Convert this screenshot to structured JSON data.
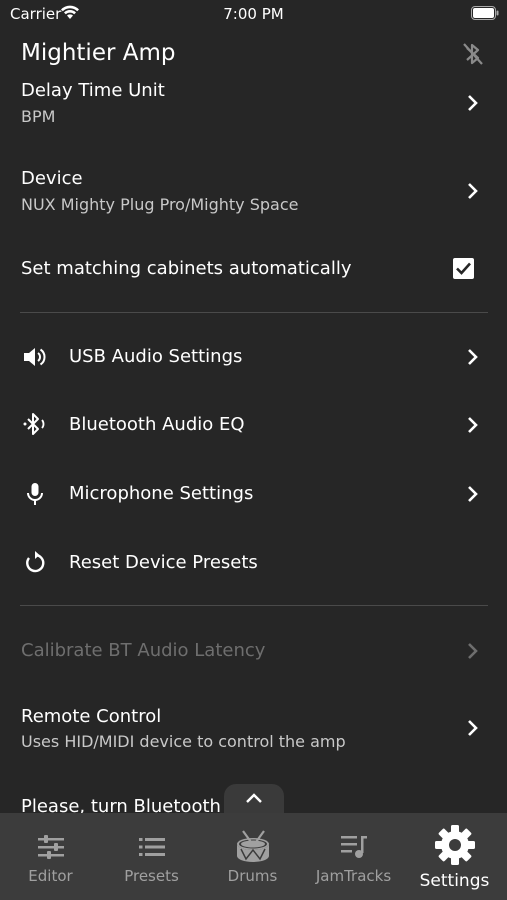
{
  "status": {
    "carrier": "Carrier",
    "time": "7:00 PM"
  },
  "app": {
    "title": "Mightier Amp"
  },
  "settings": {
    "delay_time_unit": {
      "title": "Delay Time Unit",
      "value": "BPM"
    },
    "device": {
      "title": "Device",
      "value": "NUX Mighty Plug Pro/Mighty Space"
    },
    "matching_cabinets": {
      "title": "Set matching cabinets automatically",
      "checked": true
    },
    "usb_audio": {
      "title": "USB Audio Settings",
      "icon": "speaker-icon"
    },
    "bt_audio_eq": {
      "title": "Bluetooth Audio EQ",
      "icon": "bluetooth-audio-icon"
    },
    "microphone": {
      "title": "Microphone Settings",
      "icon": "microphone-icon"
    },
    "reset_presets": {
      "title": "Reset Device Presets",
      "icon": "reset-icon"
    },
    "calibrate_bt": {
      "title": "Calibrate BT Audio Latency",
      "enabled": false
    },
    "remote_control": {
      "title": "Remote Control",
      "value": "Uses HID/MIDI device to control the amp"
    },
    "bluetooth_notice": {
      "title": "Please, turn Bluetooth"
    }
  },
  "tabs": [
    {
      "label": "Editor",
      "icon": "sliders-icon"
    },
    {
      "label": "Presets",
      "icon": "list-icon"
    },
    {
      "label": "Drums",
      "icon": "drum-icon"
    },
    {
      "label": "JamTracks",
      "icon": "music-list-icon"
    },
    {
      "label": "Settings",
      "icon": "gear-icon",
      "active": true
    }
  ],
  "colors": {
    "background": "#262626",
    "tabbar": "#3c3c3c",
    "divider": "#4a4a4a",
    "subtitle": "#c8c8c8",
    "disabled": "#6e6e6e"
  }
}
